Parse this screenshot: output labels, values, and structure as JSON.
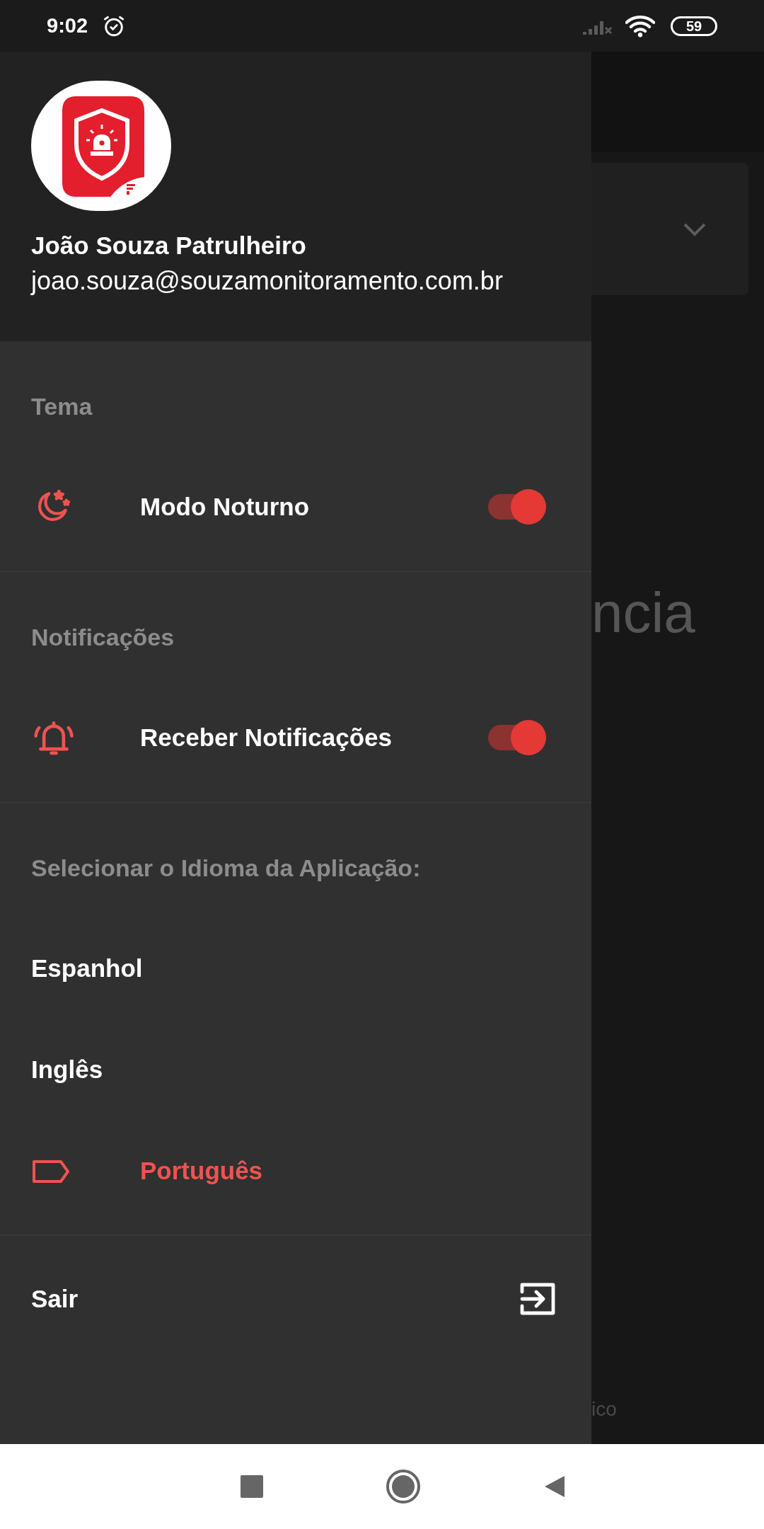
{
  "status_bar": {
    "time": "9:02",
    "battery": "59"
  },
  "drawer": {
    "user": {
      "name": "João Souza Patrulheiro",
      "email": "joao.souza@souzamonitoramento.com.br"
    },
    "theme": {
      "title": "Tema",
      "toggle": {
        "label": "Modo Noturno",
        "on": true
      }
    },
    "notifications": {
      "title": "Notificações",
      "toggle": {
        "label": "Receber Notificações",
        "on": true
      }
    },
    "language": {
      "title": "Selecionar o Idioma da Aplicação:",
      "options": [
        {
          "label": "Espanhol",
          "selected": false
        },
        {
          "label": "Inglês",
          "selected": false
        },
        {
          "label": "Português",
          "selected": true
        }
      ]
    },
    "logout": {
      "label": "Sair"
    }
  },
  "background": {
    "heading_fragment": "ncia",
    "caption_fragment": "ico"
  }
}
